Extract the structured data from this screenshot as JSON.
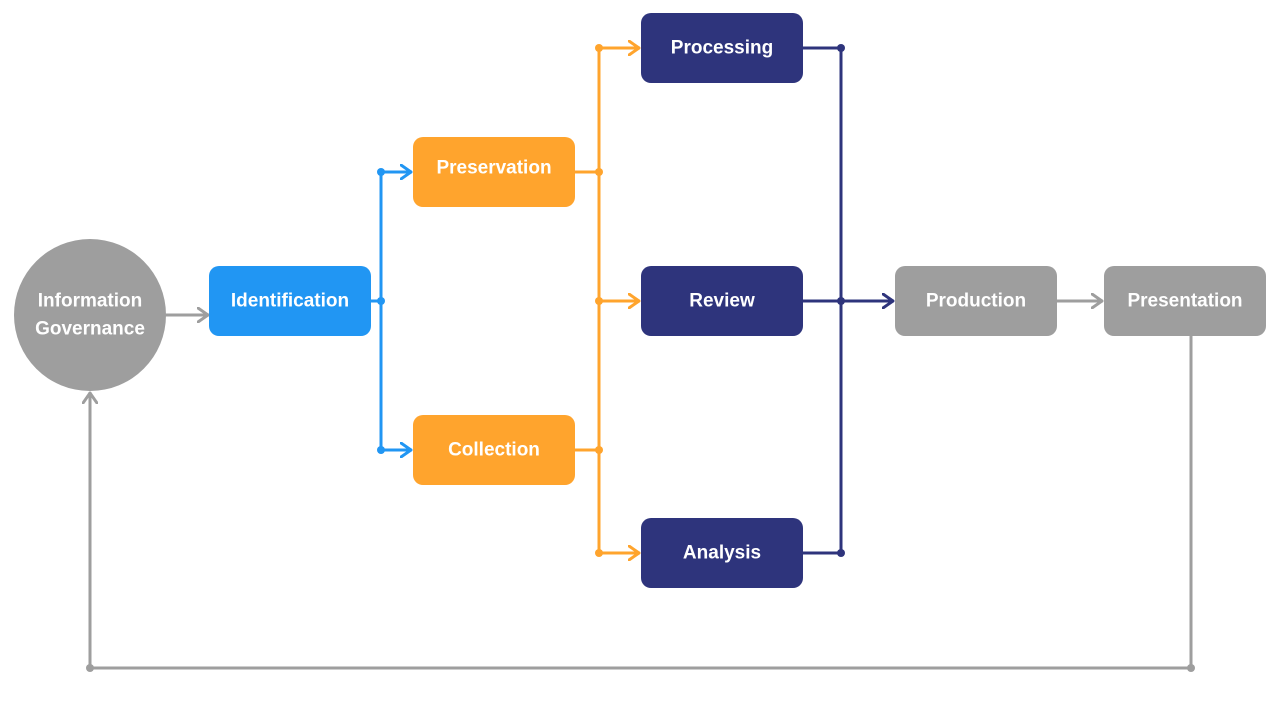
{
  "colors": {
    "gray": "#9e9e9e",
    "blue": "#2196f3",
    "orange": "#ffa42d",
    "navy": "#2e347c"
  },
  "nodes": {
    "governance": {
      "line1": "Information",
      "line2": "Governance"
    },
    "identification": "Identification",
    "preservation": "Preservation",
    "collection": "Collection",
    "processing": "Processing",
    "review": "Review",
    "analysis": "Analysis",
    "production": "Production",
    "presentation": "Presentation"
  }
}
